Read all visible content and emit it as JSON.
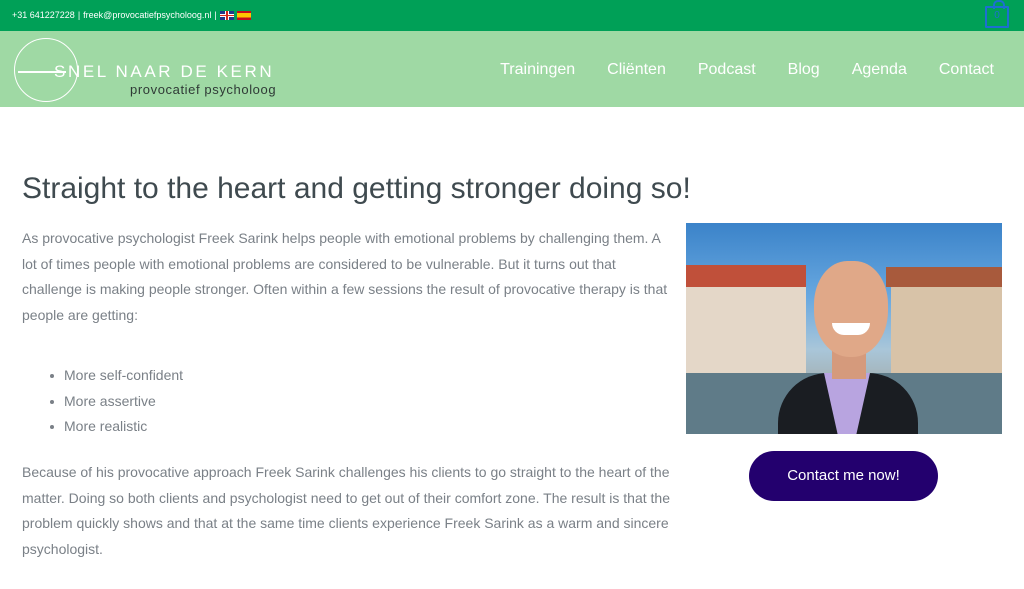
{
  "topbar": {
    "phone": "+31 641227228",
    "separator1": "|",
    "email": "freek@provocatiefpsycholoog.nl",
    "separator2": "|",
    "cart_count": "0"
  },
  "header": {
    "logo_title": "SNEL NAAR DE KERN",
    "logo_subtitle": "provocatief psycholoog",
    "nav": [
      "Trainingen",
      "Cliënten",
      "Podcast",
      "Blog",
      "Agenda",
      "Contact"
    ]
  },
  "main": {
    "headline": "Straight to the heart and getting stronger doing so!",
    "intro": "As provocative psychologist Freek Sarink helps people with emotional problems by challenging them. A lot of times people with emotional problems are considered to be vulnerable. But it turns out that challenge is making people stronger. Often within a few sessions the result of provocative therapy is that people are getting:",
    "bullets": [
      "More self-confident",
      "More assertive",
      "More realistic"
    ],
    "outro": "Because of his provocative approach Freek Sarink challenges his clients to go straight to the heart of the matter. Doing so both clients and psychologist need to get out of their comfort zone. The result is that the problem quickly shows and that at the same time clients experience Freek Sarink as a warm and sincere psychologist.",
    "cta_label": "Contact me now!"
  },
  "colors": {
    "topbar_bg": "#00a057",
    "header_bg": "#9fd9a4",
    "cta_bg": "#23006e",
    "cart_accent": "#1d6fd1"
  }
}
